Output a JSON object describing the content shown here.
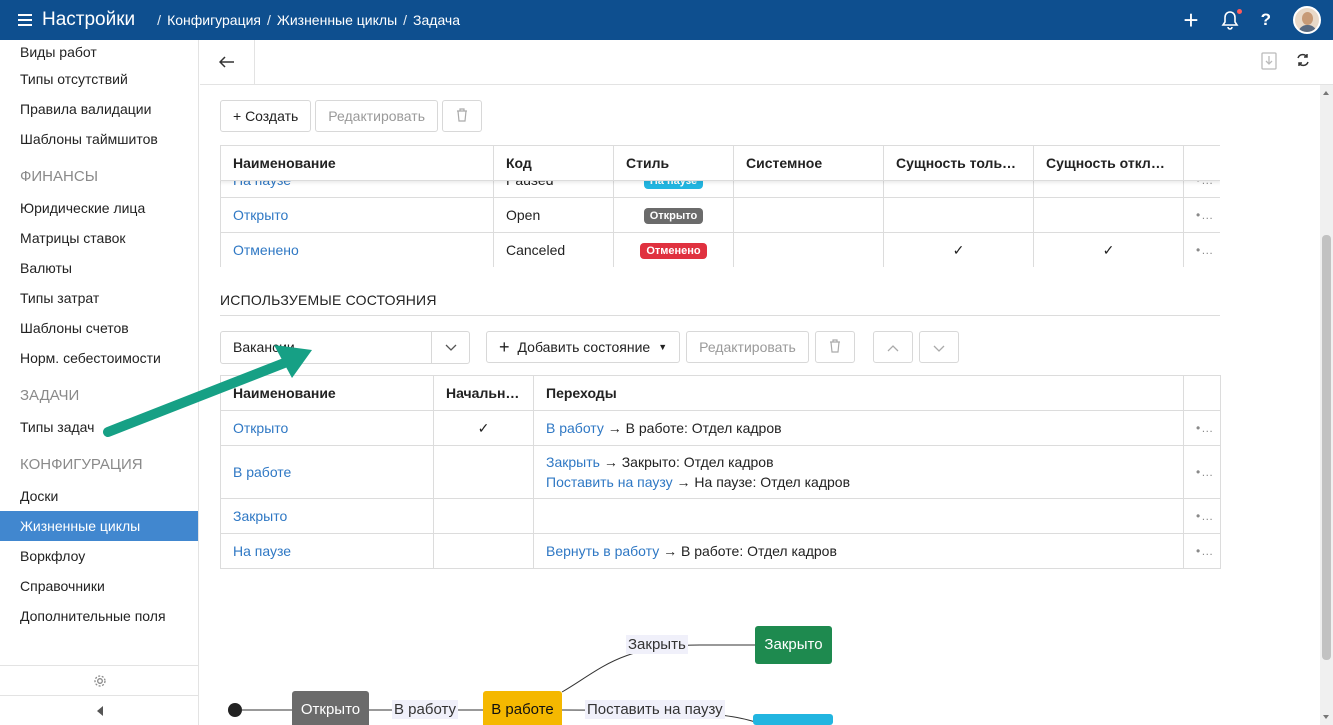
{
  "header": {
    "app_title": "Настройки",
    "breadcrumbs": [
      "Конфигурация",
      "Жизненные циклы",
      "Задача"
    ],
    "colors": {
      "topbar": "#0e4f8f",
      "accent": "#4187cf"
    }
  },
  "sidebar": {
    "items_top": [
      "Виды работ",
      "Типы отсутствий",
      "Правила валидации",
      "Шаблоны таймшитов"
    ],
    "section_finance": "ФИНАНСЫ",
    "items_finance": [
      "Юридические лица",
      "Матрицы ставок",
      "Валюты",
      "Типы затрат",
      "Шаблоны счетов",
      "Норм. себестоимости"
    ],
    "section_tasks": "ЗАДАЧИ",
    "items_tasks": [
      "Типы задач"
    ],
    "section_config": "КОНФИГУРАЦИЯ",
    "items_config": [
      "Доски",
      "Жизненные циклы",
      "Воркфлоу",
      "Справочники",
      "Дополнительные поля"
    ],
    "active_item": "Жизненные циклы"
  },
  "toolbar": {
    "create_label": "+ Создать",
    "edit_label": "Редактировать"
  },
  "states_table": {
    "columns": [
      "Наименование",
      "Код",
      "Стиль",
      "Системное",
      "Сущность только...",
      "Сущность отклю..."
    ],
    "rows": [
      {
        "name": "На паузе",
        "code": "Paused",
        "style": "На паузе",
        "style_color": "#22b5e0",
        "system": "",
        "readonly": "",
        "disabled": ""
      },
      {
        "name": "Открыто",
        "code": "Open",
        "style": "Открыто",
        "style_color": "#6b6b6b",
        "system": "",
        "readonly": "",
        "disabled": ""
      },
      {
        "name": "Отменено",
        "code": "Canceled",
        "style": "Отменено",
        "style_color": "#e0313f",
        "system": "",
        "readonly": "✓",
        "disabled": "✓"
      }
    ]
  },
  "used_states": {
    "title": "ИСПОЛЬЗУЕМЫЕ СОСТОЯНИЯ",
    "select_value": "Вакансии",
    "add_state_label": "Добавить состояние",
    "edit_label": "Редактировать",
    "columns": [
      "Наименование",
      "Начальное",
      "Переходы"
    ],
    "rows": [
      {
        "name": "Открыто",
        "initial": "✓",
        "transitions": [
          {
            "link": "В работу",
            "target": "В работе: Отдел кадров"
          }
        ]
      },
      {
        "name": "В работе",
        "initial": "",
        "transitions": [
          {
            "link": "Закрыть",
            "target": "Закрыто: Отдел кадров"
          },
          {
            "link": "Поставить на паузу",
            "target": "На паузе: Отдел кадров"
          }
        ]
      },
      {
        "name": "Закрыто",
        "initial": "",
        "transitions": []
      },
      {
        "name": "На паузе",
        "initial": "",
        "transitions": [
          {
            "link": "Вернуть в работу",
            "target": "В работе: Отдел кадров"
          }
        ]
      }
    ]
  },
  "diagram": {
    "nodes": [
      {
        "label": "Открыто",
        "color": "#6b6b6b"
      },
      {
        "label": "В работе",
        "color": "#f5b800"
      },
      {
        "label": "Закрыто",
        "color": "#1e8a4f"
      },
      {
        "label": "",
        "color": "#22b5e0"
      }
    ],
    "edges": [
      "В работу",
      "Закрыть",
      "Поставить на паузу"
    ]
  },
  "annotation": {
    "arrow_color": "#16a085"
  }
}
